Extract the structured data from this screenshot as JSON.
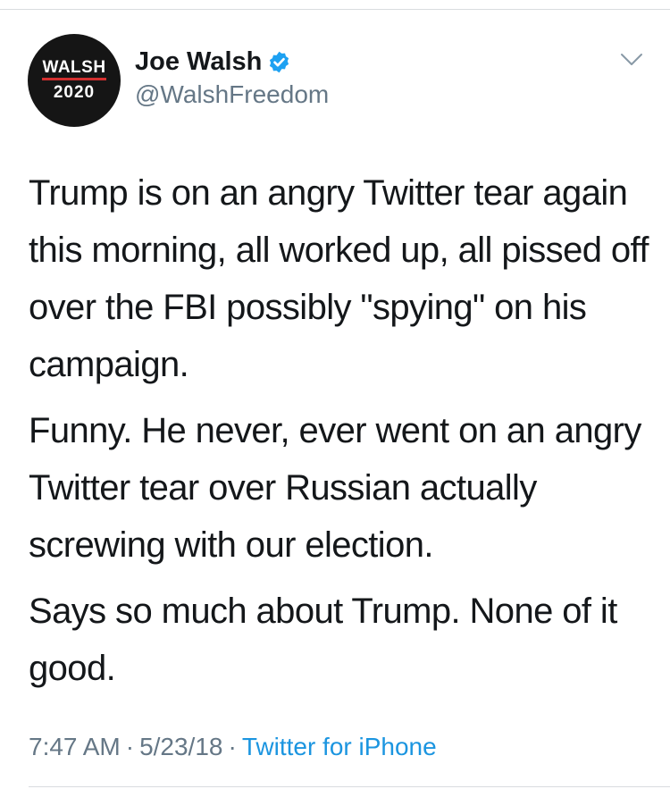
{
  "tweet": {
    "author": {
      "display_name": "Joe Walsh",
      "handle": "@WalshFreedom",
      "verified": true,
      "avatar": {
        "line1": "WALSH",
        "line2": "2020",
        "background": "#151515",
        "accent": "#d32f2f"
      }
    },
    "text": {
      "paragraph1": "Trump is on an angry Twitter tear again this morning, all worked up, all pissed off over the FBI possibly \"spying\" on his campaign.",
      "paragraph2": "Funny. He never, ever went on an angry Twitter tear over Russian actually screwing with our election.",
      "paragraph3": "Says so much about Trump. None of it good."
    },
    "meta": {
      "time": "7:47 AM",
      "date": "5/23/18",
      "separator": "·",
      "source": "Twitter for iPhone"
    },
    "icons": {
      "verified": "verified-badge-icon",
      "menu": "chevron-down-icon"
    },
    "colors": {
      "text": "#14171a",
      "secondary": "#657786",
      "link": "#1b95e0",
      "verified": "#1da1f2"
    }
  }
}
